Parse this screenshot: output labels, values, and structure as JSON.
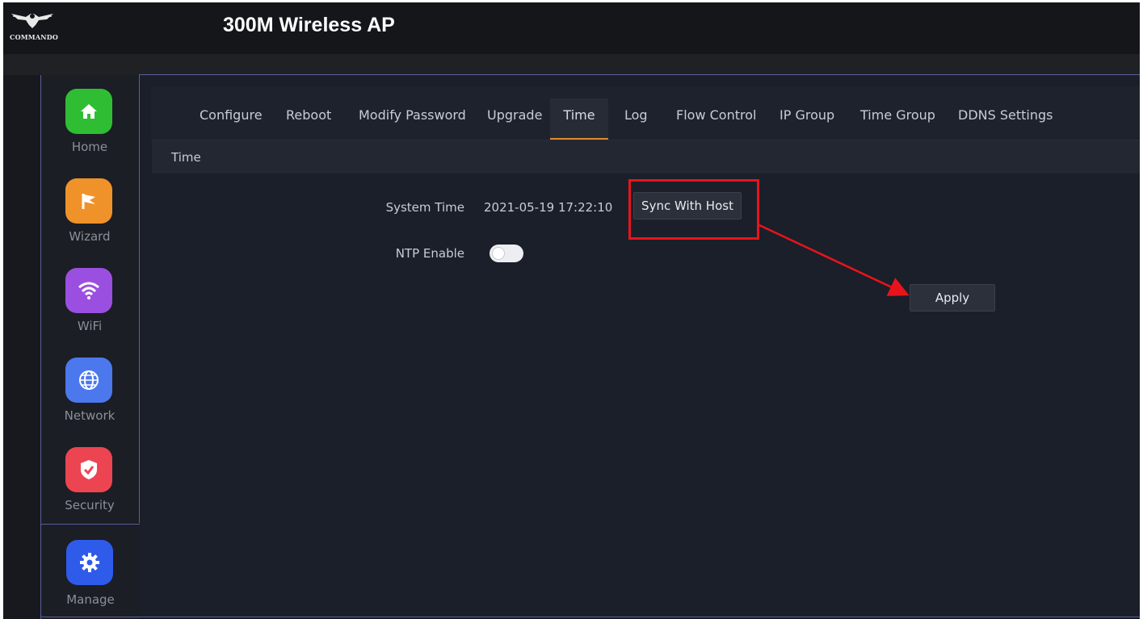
{
  "header": {
    "logo_text": "COMMANDO",
    "title": "300M Wireless AP"
  },
  "sidebar": {
    "items": [
      {
        "label": "Home",
        "icon": "home-icon",
        "color": "#2fbe33"
      },
      {
        "label": "Wizard",
        "icon": "flag-icon",
        "color": "#f0922a"
      },
      {
        "label": "WiFi",
        "icon": "wifi-icon",
        "color": "#9b4fe0"
      },
      {
        "label": "Network",
        "icon": "globe-icon",
        "color": "#4c78ee"
      },
      {
        "label": "Security",
        "icon": "shield-icon",
        "color": "#ec4551"
      },
      {
        "label": "Manage",
        "icon": "gear-icon",
        "color": "#2f5bea"
      }
    ],
    "active": "Manage"
  },
  "tabs": [
    {
      "label": "Configure"
    },
    {
      "label": "Reboot"
    },
    {
      "label": "Modify Password"
    },
    {
      "label": "Upgrade"
    },
    {
      "label": "Time"
    },
    {
      "label": "Log"
    },
    {
      "label": "Flow Control"
    },
    {
      "label": "IP Group"
    },
    {
      "label": "Time Group"
    },
    {
      "label": "DDNS Settings"
    }
  ],
  "active_tab": "Time",
  "section": {
    "title": "Time"
  },
  "form": {
    "system_time_label": "System Time",
    "system_time_value": "2021-05-19 17:22:10",
    "sync_button": "Sync With Host",
    "ntp_label": "NTP Enable",
    "ntp_enabled": false,
    "apply_button": "Apply"
  },
  "colors": {
    "accent": "#e08a2c",
    "annotation": "#e8141c"
  }
}
